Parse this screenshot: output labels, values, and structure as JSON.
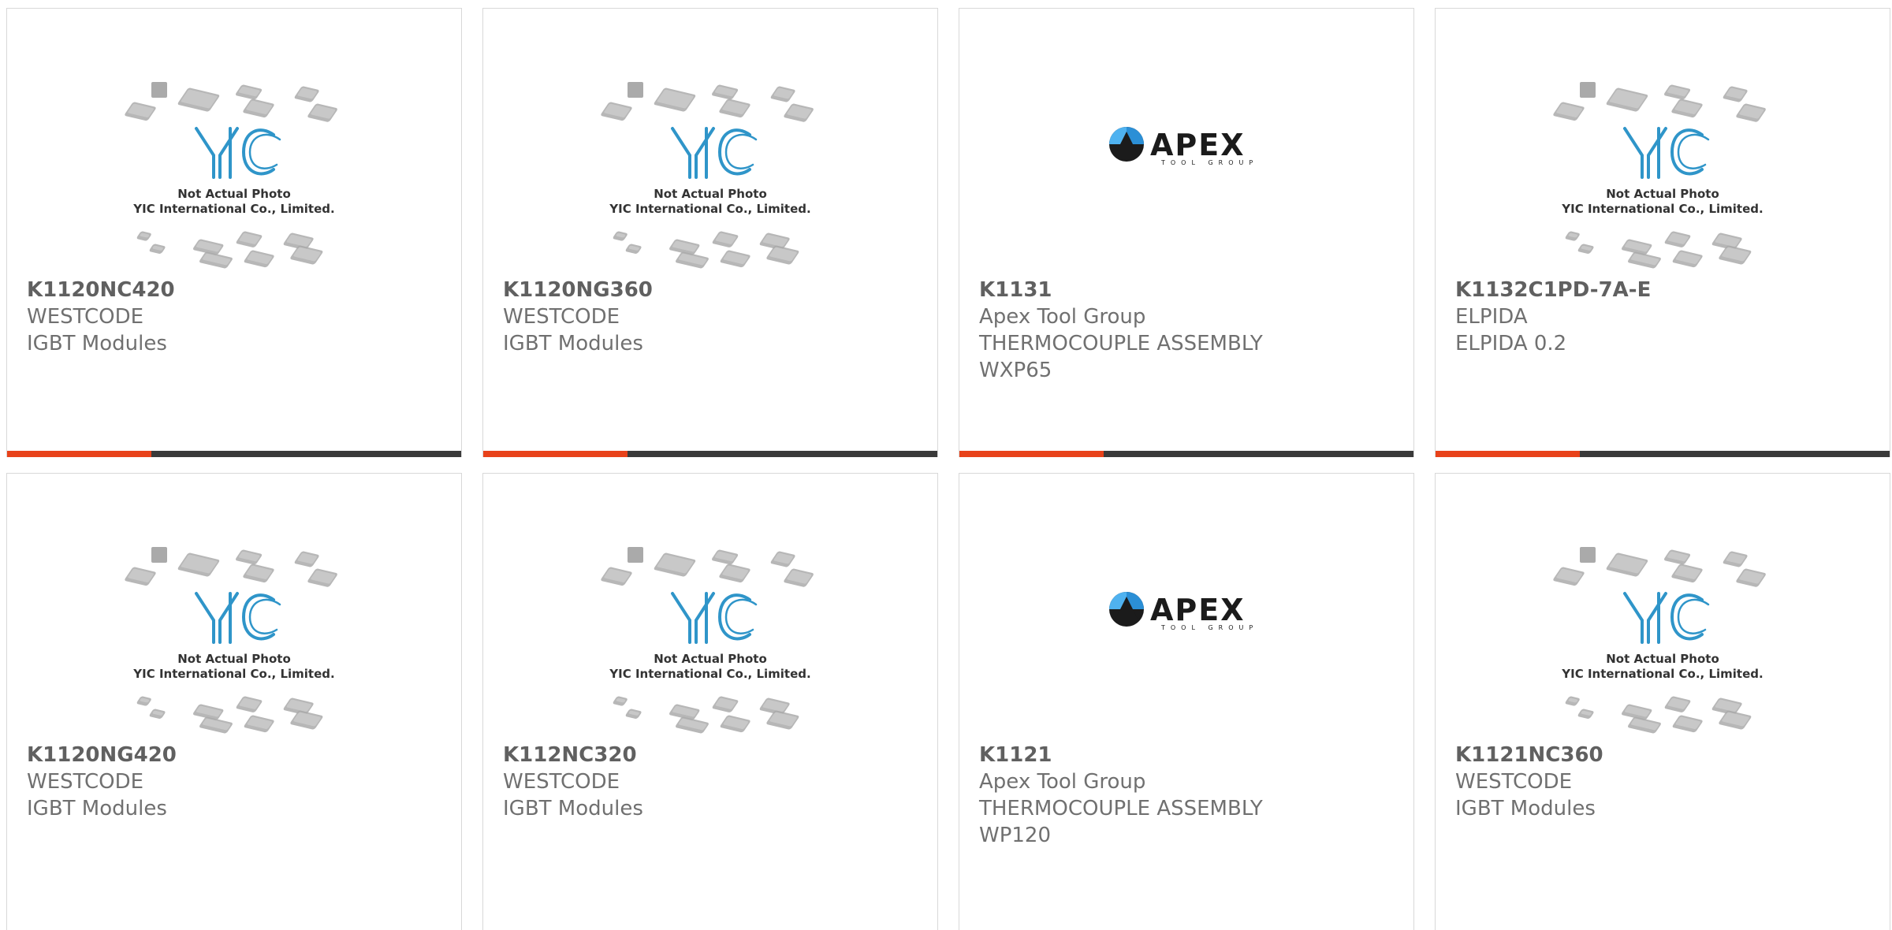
{
  "colors": {
    "accent": "#e8421a",
    "bar": "#3a3a3a",
    "yic_blue": "#2f95c9",
    "chip_gray": "#aaaaaa"
  },
  "placeholder": {
    "line1": "Not Actual Photo",
    "line2": "YIC International Co., Limited.",
    "logo_text": "YIC"
  },
  "apex": {
    "logo_text": "APEX",
    "logo_sub": "TOOL GROUP"
  },
  "products": [
    {
      "part": "K1120NC420",
      "brand": "WESTCODE",
      "desc": "IGBT Modules",
      "extra": "",
      "image": "yic-placeholder"
    },
    {
      "part": "K1120NG360",
      "brand": "WESTCODE",
      "desc": "IGBT Modules",
      "extra": "",
      "image": "yic-placeholder"
    },
    {
      "part": "K1131",
      "brand": "Apex Tool Group",
      "desc": "THERMOCOUPLE ASSEMBLY",
      "extra": "WXP65",
      "image": "apex-logo"
    },
    {
      "part": "K1132C1PD-7A-E",
      "brand": "ELPIDA",
      "desc": "ELPIDA 0.2",
      "extra": "",
      "image": "yic-placeholder"
    },
    {
      "part": "K1120NG420",
      "brand": "WESTCODE",
      "desc": "IGBT Modules",
      "extra": "",
      "image": "yic-placeholder"
    },
    {
      "part": "K112NC320",
      "brand": "WESTCODE",
      "desc": "IGBT Modules",
      "extra": "",
      "image": "yic-placeholder"
    },
    {
      "part": "K1121",
      "brand": "Apex Tool Group",
      "desc": "THERMOCOUPLE ASSEMBLY",
      "extra": "WP120",
      "image": "apex-logo"
    },
    {
      "part": "K1121NC360",
      "brand": "WESTCODE",
      "desc": "IGBT Modules",
      "extra": "",
      "image": "yic-placeholder"
    }
  ]
}
